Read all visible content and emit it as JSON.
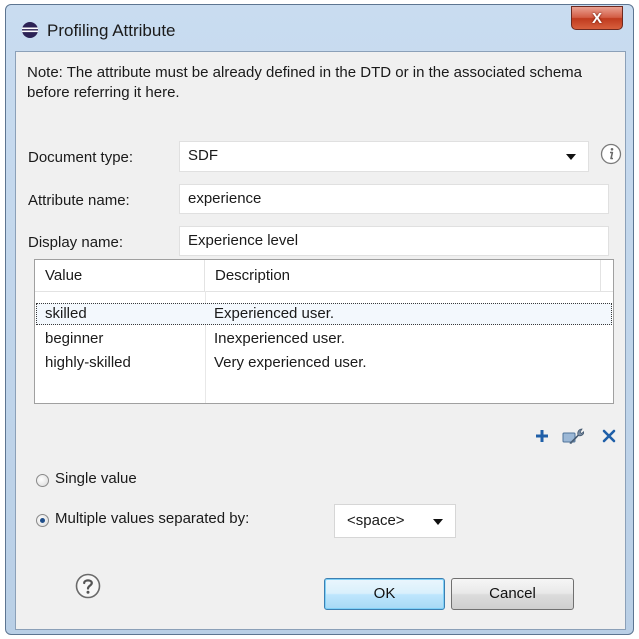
{
  "window": {
    "title": "Profiling Attribute",
    "close_label": "X"
  },
  "note": "Note: The attribute must be already defined in the DTD or in the associated schema before referring it here.",
  "form": {
    "document_type_label": "Document type:",
    "document_type_value": "SDF",
    "attribute_name_label": "Attribute name:",
    "attribute_name_value": "experience",
    "display_name_label": "Display name:",
    "display_name_value": "Experience level"
  },
  "table": {
    "columns": [
      "Value",
      "Description"
    ],
    "rows": [
      {
        "value": "skilled",
        "description": "Experienced user."
      },
      {
        "value": "beginner",
        "description": "Inexperienced user."
      },
      {
        "value": "highly-skilled",
        "description": "Very experienced user."
      }
    ],
    "selected_row": 0
  },
  "options": {
    "single_value_label": "Single value",
    "multiple_values_label": "Multiple values separated by:",
    "selected": "multiple",
    "separator_value": "<space>"
  },
  "buttons": {
    "ok_label": "OK",
    "cancel_label": "Cancel"
  },
  "icons": {
    "app": "eclipse-icon",
    "info": "info-icon",
    "help": "help-icon",
    "add": "plus-icon",
    "edit": "wrench-icon",
    "remove": "close-icon"
  },
  "colors": {
    "accent_blue": "#1f5fa8",
    "close_red": "#c03a1e"
  }
}
